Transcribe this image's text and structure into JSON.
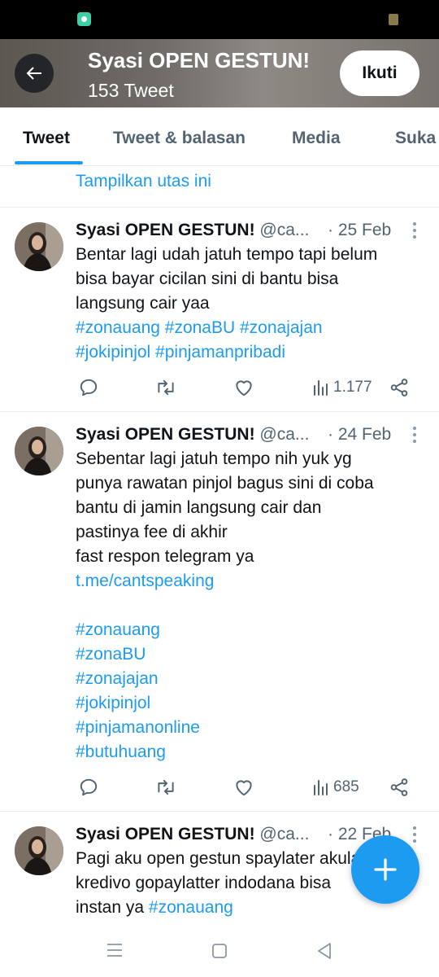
{
  "header": {
    "title": "Syasi OPEN GESTUN!",
    "subtitle": "153 Tweet",
    "follow_label": "Ikuti"
  },
  "tabs": [
    {
      "label": "Tweet",
      "active": true
    },
    {
      "label": "Tweet & balasan",
      "active": false
    },
    {
      "label": "Media",
      "active": false
    },
    {
      "label": "Suka",
      "active": false
    }
  ],
  "show_thread": "Tampilkan utas ini",
  "tweets": [
    {
      "name": "Syasi OPEN GESTUN!",
      "handle": "@ca...",
      "date": "· 25 Feb",
      "lines": [
        {
          "text": "Bentar lagi udah jatuh tempo tapi belum",
          "link": false
        },
        {
          "text": "bisa bayar cicilan sini di bantu bisa",
          "link": false
        },
        {
          "text": "langsung cair yaa",
          "link": false
        },
        {
          "text": "#zonauang #zonaBU #zonajajan",
          "link": true
        },
        {
          "text": "#jokipinjol #pinjamanpribadi",
          "link": true
        }
      ],
      "views": "1.177"
    },
    {
      "name": "Syasi OPEN GESTUN!",
      "handle": "@ca...",
      "date": "· 24 Feb",
      "lines": [
        {
          "text": "Sebentar lagi jatuh tempo nih yuk yg",
          "link": false
        },
        {
          "text": "punya rawatan pinjol bagus sini di coba",
          "link": false
        },
        {
          "text": "bantu di jamin langsung cair dan",
          "link": false
        },
        {
          "text": "pastinya fee di akhir",
          "link": false
        },
        {
          "text": "fast respon telegram ya",
          "link": false
        },
        {
          "text": "t.me/cantspeaking",
          "link": true
        },
        {
          "text": "",
          "link": false
        },
        {
          "text": "#zonauang",
          "link": true
        },
        {
          "text": "#zonaBU",
          "link": true
        },
        {
          "text": "#zonajajan",
          "link": true
        },
        {
          "text": "#jokipinjol",
          "link": true
        },
        {
          "text": "#pinjamanonline",
          "link": true
        },
        {
          "text": "#butuhuang",
          "link": true
        }
      ],
      "views": "685"
    },
    {
      "name": "Syasi OPEN GESTUN!",
      "handle": "@ca...",
      "date": "· 22 Feb",
      "lines": [
        {
          "text": "Pagi aku open gestun spaylater akulaku",
          "link": false
        },
        {
          "text": "kredivo gopaylatter indodana bisa",
          "link": false
        },
        {
          "text": "instan ya ",
          "link": false,
          "suffix": "#zonauang"
        }
      ],
      "views": ""
    }
  ],
  "icons": {
    "back": "arrow-left-icon",
    "reply": "reply-icon",
    "retweet": "retweet-icon",
    "like": "heart-icon",
    "views": "views-icon",
    "share": "share-icon",
    "compose": "plus-icon"
  },
  "colors": {
    "accent": "#1d9bf0",
    "text": "#0f1419",
    "muted": "#536471"
  }
}
